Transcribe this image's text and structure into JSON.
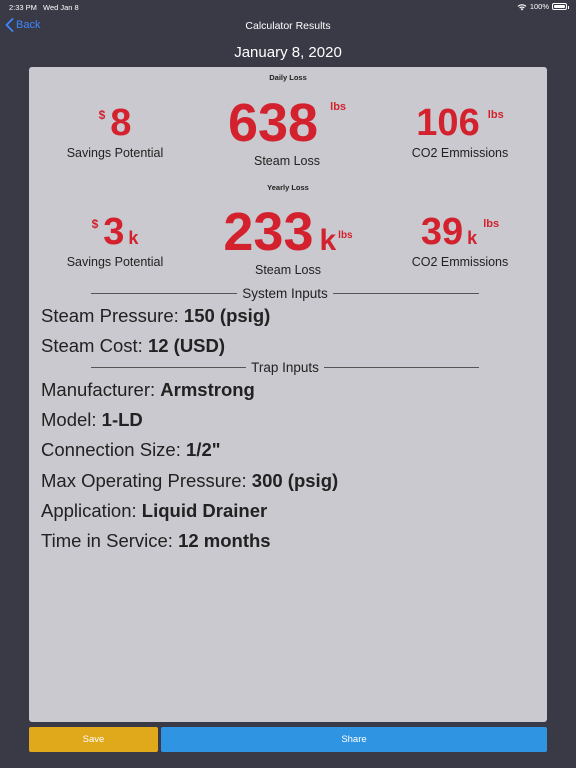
{
  "status_bar": {
    "time": "2:33 PM",
    "date": "Wed Jan 8",
    "battery": "100%"
  },
  "nav": {
    "back_label": "Back",
    "title": "Calculator Results"
  },
  "report_date": "January 8, 2020",
  "daily": {
    "label": "Daily Loss",
    "savings": {
      "currency": "$",
      "value": "8",
      "desc": "Savings Potential"
    },
    "steam": {
      "value": "638",
      "unit": "lbs",
      "desc": "Steam Loss"
    },
    "co2": {
      "value": "106",
      "unit": "lbs",
      "desc": "CO2 Emmissions"
    }
  },
  "yearly": {
    "label": "Yearly Loss",
    "savings": {
      "currency": "$",
      "value": "3",
      "suffix": "k",
      "desc": "Savings Potential"
    },
    "steam": {
      "value": "233",
      "suffix": "k",
      "unit": "lbs",
      "desc": "Steam Loss"
    },
    "co2": {
      "value": "39",
      "suffix": "k",
      "unit": "lbs",
      "desc": "CO2 Emmissions"
    }
  },
  "system_inputs": {
    "header": "System Inputs",
    "rows": [
      {
        "label": "Steam Pressure:",
        "value": "150 (psig)"
      },
      {
        "label": "Steam Cost:",
        "value": "12 (USD)"
      }
    ]
  },
  "trap_inputs": {
    "header": "Trap Inputs",
    "rows": [
      {
        "label": "Manufacturer:",
        "value": "Armstrong"
      },
      {
        "label": "Model:",
        "value": "1-LD"
      },
      {
        "label": "Connection Size:",
        "value": "1/2\""
      },
      {
        "label": "Max Operating Pressure:",
        "value": "300 (psig)"
      },
      {
        "label": "Application:",
        "value": "Liquid Drainer"
      },
      {
        "label": "Time in Service:",
        "value": "12 months"
      }
    ]
  },
  "actions": {
    "save_label": "Save",
    "share_label": "Share"
  },
  "colors": {
    "accent_red": "#d3212d",
    "save": "#e0a91b",
    "share": "#2f95e3",
    "link": "#3d86ff",
    "background": "#3a3a47",
    "card": "#c9c9cf"
  }
}
